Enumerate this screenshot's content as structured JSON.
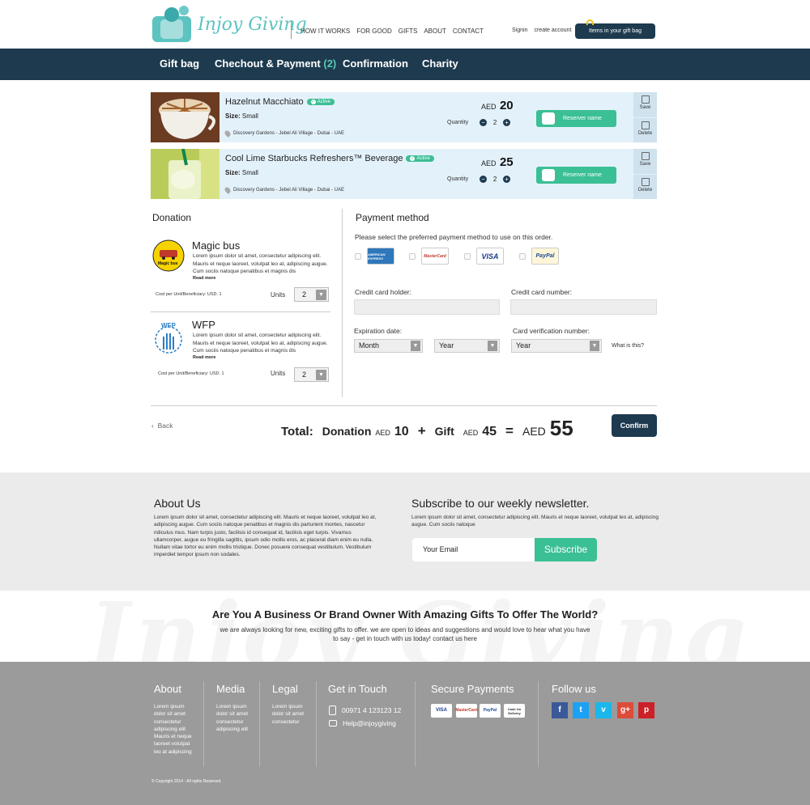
{
  "brand": {
    "name": "Injoy Giving"
  },
  "top_nav": [
    "HOW IT WORKS",
    "FOR GOOD",
    "GIFTS",
    "ABOUT",
    "CONTACT"
  ],
  "account_links": {
    "signin": "Signin",
    "create": "create account"
  },
  "gift_bag_button": "Items in your gift bag",
  "steps": [
    {
      "label": "Gift bag"
    },
    {
      "label": "Chechout & Payment",
      "count": "(2)"
    },
    {
      "label": "Confirmation"
    },
    {
      "label": "Charity"
    }
  ],
  "colors": {
    "navy": "#1d3a4f",
    "green": "#3bbf95",
    "teal": "#5cc3c0",
    "row_bg": "#e3f1fa"
  },
  "products": [
    {
      "name": "Hazelnut Macchiato",
      "badge": "Active",
      "size_label": "Size:",
      "size": "Small",
      "location": "Discovery Gardens - Jebel Ali Village - Dubai - UAE",
      "currency": "AED",
      "price": "20",
      "qty_label": "Quantity",
      "qty": "2",
      "reserve": "Reserver name",
      "save": "Save",
      "delete": "Delete"
    },
    {
      "name": "Cool Lime Starbucks Refreshers™ Beverage",
      "badge": "Active",
      "size_label": "Size:",
      "size": "Small",
      "location": "Discovery Gardens - Jebel Ali Village - Dubai - UAE",
      "currency": "AED",
      "price": "25",
      "qty_label": "Quantity",
      "qty": "2",
      "reserve": "Reserver name",
      "save": "Save",
      "delete": "Delete"
    }
  ],
  "donation": {
    "title": "Donation",
    "items": [
      {
        "name": "Magic bus",
        "logo_text": "Magic bus",
        "text": "Lorem ipsum dolor sit amet, consectetur adipiscing elit. Mauris et neque laoreet, volutpat leo at, adipiscing augue. Cum sociis natoque penatibus et magnis dis",
        "more": "Read more",
        "cost": "Cost per Unit/Beneficiary: USD. 1",
        "units_label": "Units",
        "units": "2"
      },
      {
        "name": "WFP",
        "logo_text": "WFP",
        "text": "Lorem ipsum dolor sit amet, consectetur adipiscing elit. Mauris et neque laoreet, volutpat leo at, adipiscing augue. Cum sociis natoque penatibus et magnis dis",
        "more": "Read more",
        "cost": "Cost per Unit/Beneficiary: USD. 1",
        "units_label": "Units",
        "units": "2"
      }
    ]
  },
  "payment": {
    "title": "Payment method",
    "note": "Please select the preferred payment method to use on this order.",
    "cards": [
      "AMERICAN EXPRESS",
      "MasterCard",
      "VISA",
      "PayPal"
    ],
    "holder_label": "Credit card holder:",
    "number_label": "Credit card number:",
    "expiry_label": "Expiration date:",
    "cvv_label": "Card verification number:",
    "month": "Month",
    "year": "Year",
    "cvv_year": "Year",
    "whatis": "What is this?"
  },
  "totals": {
    "back": "Back",
    "total_label": "Total:",
    "donation_label": "Donation",
    "currency": "AED",
    "donation_amount": "10",
    "plus": "+",
    "gift_label": "Gift",
    "gift_amount": "45",
    "equals": "=",
    "grand_amount": "55",
    "confirm": "Confirm"
  },
  "about": {
    "title": "About Us",
    "text": "Lorem ipsum dolor sit amet, consectetur adipiscing elit. Mauris et neque laoreet, volutpat leo at, adipiscing augue. Cum sociis natoque penatibus et magnis dis parturient montes, nascetur ridiculus mus. Nam turpis justo, facilisis id consequat id, facilisis eget turpis. Vivamus ullamcorper, augue eu fringilla sagittis, ipsum odio mollis eros, ac placerat diam enim eu nulla. Nullam vitae tortor eu enim mollis tristique. Donec posuere consequat vestibulum. Vestibulum imperdiet tempor ipsum non sodales."
  },
  "newsletter": {
    "title": "Subscribe to our weekly newsletter.",
    "text": "Lorem ipsum dolor sit amet, consectetur adipiscing elit. Mauris et neque laoreet, volutpat leo at, adipiscing augue. Cum sociis natoque",
    "placeholder": "Your Email",
    "button": "Subscribe"
  },
  "business": {
    "title": "Are You A Business Or Brand Owner With Amazing Gifts To Offer The World?",
    "text": "we are always looking for new, exciting gifts to offer. we are open to ideas and suggestions and would love to hear what you have to say - get in touch with us today! contact us here"
  },
  "footer": {
    "about_title": "About",
    "about_text": "Lorem ipsum dolor sit amet consectetur adipiscing elit Mauris et neque laoreet volutpat leo at adipiscing",
    "media_title": "Media",
    "media_text": "Lorem ipsum dolor sit amet consectetur adipiscing elit",
    "legal_title": "Legal",
    "legal_text": "Lorem ipsum dolor sit amet consectetur",
    "contact_title": "Get in Touch",
    "phone": "00971 4 123123 12",
    "email": "Help@injoygiving",
    "payments_title": "Secure Payments",
    "payment_cards": [
      "VISA",
      "MasterCard",
      "PayPal",
      "Cash On Delivery"
    ],
    "follow_title": "Follow us",
    "social": [
      "f",
      "t",
      "v",
      "g+",
      "p"
    ],
    "copyright": "© Copyright 2014 - All rights Reserved."
  }
}
